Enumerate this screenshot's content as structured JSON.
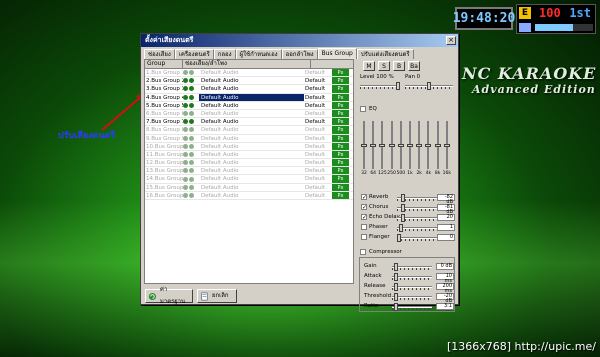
{
  "clock": {
    "time": "19:48:20"
  },
  "status": {
    "badge": "E",
    "count": "100",
    "track": "1st",
    "progress": 0.65
  },
  "logo": {
    "line1": "NC KARAOKE",
    "line2": "Advanced Edition"
  },
  "annotation": {
    "text": "ปรับเสียงดนตรี"
  },
  "watermark": {
    "text": "[1366x768] http://upic.me/"
  },
  "dialog": {
    "title": "ตั้งค่าเสียงดนตรี",
    "close": "×",
    "tabs": [
      "ช่องเสียง",
      "เครื่องดนตรี",
      "กลอง",
      "ผู้ใช้กำหนดเอง",
      "ออกลำโพง",
      "Bus Group",
      "ปรับแต่งเสียงดนตรี"
    ],
    "active_tab": 5,
    "grid": {
      "header_group": "Group",
      "header_channel": "ช่องเสียง/ลำโพง",
      "rows": [
        {
          "name": "1.Bus Group 1",
          "device": "Default Audio",
          "def": "Default",
          "px": "Px",
          "state": "disabled"
        },
        {
          "name": "2.Bus Group 2",
          "device": "Default Audio",
          "def": "Default",
          "px": "Px",
          "state": "enabled"
        },
        {
          "name": "3.Bus Group 3",
          "device": "Default Audio",
          "def": "Default",
          "px": "Px",
          "state": "enabled"
        },
        {
          "name": "4.Bus Group 4",
          "device": "Default Audio",
          "def": "Default",
          "px": "Px",
          "state": "selected"
        },
        {
          "name": "5.Bus Group 5",
          "device": "Default Audio",
          "def": "Default",
          "px": "Px",
          "state": "enabled"
        },
        {
          "name": "6.Bus Group 6",
          "device": "Default Audio",
          "def": "Default",
          "px": "Px",
          "state": "disabled"
        },
        {
          "name": "7.Bus Group 7",
          "device": "Default Audio",
          "def": "Default",
          "px": "Px",
          "state": "enabled"
        },
        {
          "name": "8.Bus Group 8",
          "device": "Default Audio",
          "def": "Default",
          "px": "Px",
          "state": "disabled"
        },
        {
          "name": "9.Bus Group 9",
          "device": "Default Audio",
          "def": "Default",
          "px": "Px",
          "state": "disabled"
        },
        {
          "name": "10.Bus Group 10",
          "device": "Default Audio",
          "def": "Default",
          "px": "Px",
          "state": "disabled"
        },
        {
          "name": "11.Bus Group 11",
          "device": "Default Audio",
          "def": "Default",
          "px": "Px",
          "state": "disabled"
        },
        {
          "name": "12.Bus Group 12",
          "device": "Default Audio",
          "def": "Default",
          "px": "Px",
          "state": "disabled"
        },
        {
          "name": "13.Bus Group 13",
          "device": "Default Audio",
          "def": "Default",
          "px": "Px",
          "state": "disabled"
        },
        {
          "name": "14.Bus Group 14",
          "device": "Default Audio",
          "def": "Default",
          "px": "Px",
          "state": "disabled"
        },
        {
          "name": "15.Bus Group 15",
          "device": "Default Audio",
          "def": "Default",
          "px": "Px",
          "state": "disabled"
        },
        {
          "name": "16.Bus Group 16",
          "device": "Default Audio",
          "def": "Default",
          "px": "Px",
          "state": "disabled"
        }
      ]
    },
    "modes": [
      "M",
      "S",
      "B",
      "Ba"
    ],
    "level_label": "Level 100 %",
    "pan_label": "Pan 0",
    "level": 1.0,
    "pan": 0.5,
    "eq_label": "EQ",
    "eq_checked": false,
    "eq_bands": [
      {
        "freq": "32",
        "level": 0.5
      },
      {
        "freq": "64",
        "level": 0.5
      },
      {
        "freq": "125",
        "level": 0.5
      },
      {
        "freq": "250",
        "level": 0.5
      },
      {
        "freq": "500",
        "level": 0.5
      },
      {
        "freq": "1k",
        "level": 0.5
      },
      {
        "freq": "2k",
        "level": 0.5
      },
      {
        "freq": "4k",
        "level": 0.5
      },
      {
        "freq": "8k",
        "level": 0.5
      },
      {
        "freq": "16k",
        "level": 0.5
      }
    ],
    "effects": [
      {
        "label": "Reverb",
        "checked": true,
        "value": "-82 dB",
        "pos": 0.1
      },
      {
        "label": "Chorus",
        "checked": true,
        "value": "-81 dB",
        "pos": 0.1
      },
      {
        "label": "Echo Delay",
        "checked": true,
        "value": "20",
        "pos": 0.1
      },
      {
        "label": "Phaser",
        "checked": false,
        "value": "1",
        "pos": 0.05
      },
      {
        "label": "Flanger",
        "checked": false,
        "value": "0",
        "pos": 0.0
      }
    ],
    "compressor_label": "Compressor",
    "compressor_checked": false,
    "compressor": [
      {
        "label": "Gain",
        "value": "0 dB",
        "pos": 0.05
      },
      {
        "label": "Attack",
        "value": "10 ms",
        "pos": 0.05
      },
      {
        "label": "Release",
        "value": "200 ms",
        "pos": 0.05
      },
      {
        "label": "Threshold",
        "value": "-20 dB",
        "pos": 0.05
      },
      {
        "label": "Ratio",
        "value": "3:1",
        "pos": 0.05
      }
    ],
    "buttons": {
      "default": "ค่ามาตรฐาน",
      "cancel": "ยกเลิก"
    }
  }
}
